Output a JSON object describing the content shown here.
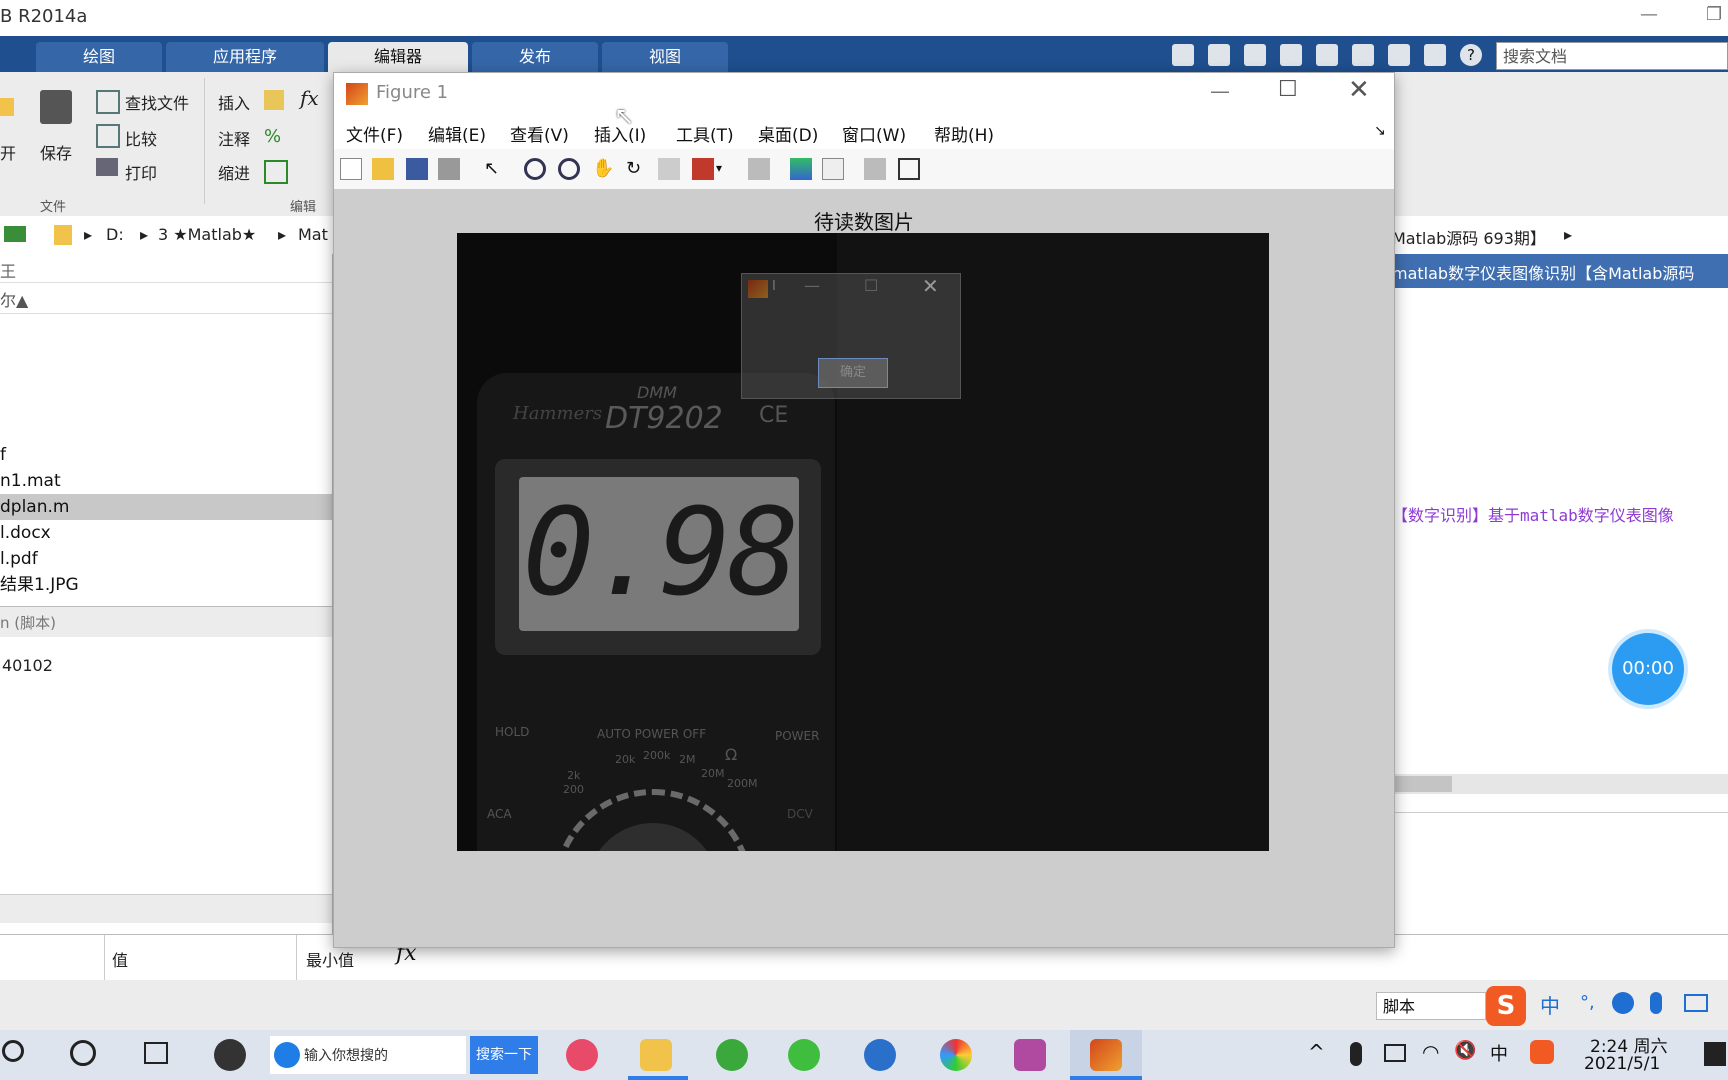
{
  "matlab": {
    "title": "B R2014a",
    "tabs": [
      "绘图",
      "应用程序",
      "编辑器",
      "发布",
      "视图"
    ],
    "active_tab": "编辑器",
    "search_placeholder": "搜索文档",
    "ribbon": {
      "open": "开",
      "save": "保存",
      "find_files": "查找文件",
      "compare": "比较",
      "print": "打印",
      "insert": "插入",
      "comment": "注释",
      "indent": "缩进",
      "group_file": "文件",
      "group_edit": "编辑"
    },
    "address": [
      "D:",
      "3 ★Matlab★",
      "Mat"
    ],
    "address_right": "Matlab源码 693期】",
    "left_panel": {
      "header": "王",
      "col_name": "尔▲",
      "files": [
        "f",
        "n1.mat",
        "dplan.m",
        "l.docx",
        "l.pdf",
        "结果1.JPG"
      ],
      "selected_index": 2,
      "details_label": "n (脚本)",
      "details_value": "40102"
    },
    "right_panel": {
      "title_line": "matlab数字仪表图像识别【含Matlab源码",
      "comment_line": "【数字识别】基于matlab数字仪表图像"
    },
    "workspace_headers": [
      "值",
      "最小值"
    ],
    "fx_label": "fx",
    "status_script": "脚本",
    "timer": "00:00"
  },
  "figure": {
    "title": "Figure 1",
    "menus": [
      "文件(F)",
      "编辑(E)",
      "查看(V)",
      "插入(I)",
      "工具(T)",
      "桌面(D)",
      "窗口(W)",
      "帮助(H)"
    ],
    "axes_title": "待读数图片",
    "image": {
      "brand": "Hammers",
      "dmm_label": "DMM",
      "model": "DT9202",
      "ce": "CE",
      "reading": "0.98",
      "hold": "HOLD",
      "auto_power_off": "AUTO POWER OFF",
      "power": "POWER",
      "aca": "ACA",
      "dcv": "DCV",
      "ranges": [
        "20k",
        "200k",
        "2M",
        "20M",
        "200M",
        "Ω",
        "2k",
        "200"
      ]
    },
    "dialog": {
      "title": "I",
      "ok": "确定"
    }
  },
  "taskbar": {
    "search_text": "输入你想搜的",
    "search_button": "搜索一下",
    "ime": "中",
    "time": "2:24 周六",
    "date": "2021/5/1"
  },
  "colors": {
    "ribbon_tab_bar": "#1f4f8e",
    "tab_inactive": "#3566a8",
    "figure_bg": "#cdcdcd",
    "comment_purple": "#8e3bd4",
    "timer_blue": "#2b9cf2"
  }
}
